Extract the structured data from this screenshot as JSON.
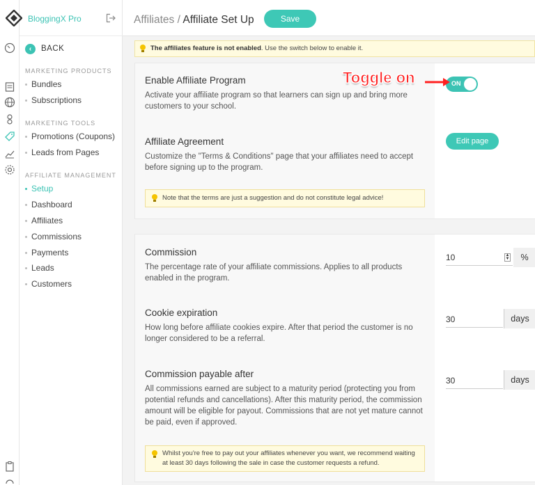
{
  "brand": {
    "name": "BloggingX Pro"
  },
  "breadcrumb": {
    "parent": "Affiliates",
    "separator": " / ",
    "current": "Affiliate Set Up"
  },
  "toolbar": {
    "save_label": "Save"
  },
  "sidebar": {
    "back_label": "BACK",
    "sections": [
      {
        "label": "MARKETING PRODUCTS",
        "items": [
          "Bundles",
          "Subscriptions"
        ]
      },
      {
        "label": "MARKETING TOOLS",
        "items": [
          "Promotions (Coupons)",
          "Leads from Pages"
        ]
      },
      {
        "label": "AFFILIATE MANAGEMENT",
        "items": [
          "Setup",
          "Dashboard",
          "Affiliates",
          "Commissions",
          "Payments",
          "Leads",
          "Customers"
        ]
      }
    ],
    "active_item": "Setup"
  },
  "banner": {
    "bold": "The affiliates feature is not enabled",
    "rest": ". Use the switch below to enable it."
  },
  "program": {
    "enable": {
      "title": "Enable Affiliate Program",
      "desc": "Activate your affiliate program so that learners can sign up and bring more customers to your school.",
      "toggle_label": "ON"
    },
    "agreement": {
      "title": "Affiliate Agreement",
      "desc": "Customize the \"Terms & Conditions\" page that your affiliates need to accept before signing up to the program.",
      "button": "Edit page",
      "note": "Note that the terms are just a suggestion and do not constitute legal advice!"
    }
  },
  "settings": {
    "commission": {
      "title": "Commission",
      "desc": "The percentage rate of your affiliate commissions. Applies to all products enabled in the program.",
      "value": "10",
      "unit": "%"
    },
    "cookie": {
      "title": "Cookie expiration",
      "desc": "How long before affiliate cookies expire. After that period the customer is no longer considered to be a referral.",
      "value": "30",
      "unit": "days"
    },
    "payable": {
      "title": "Commission payable after",
      "desc": "All commissions earned are subject to a maturity period (protecting you from potential refunds and cancellations). After this maturity period, the commission amount will be eligible for payout. Commissions that are not yet mature cannot be paid, even if approved.",
      "value": "30",
      "unit": "days",
      "note": "Whilst you're free to pay out your affiliates whenever you want, we recommend waiting at least 30 days following the sale in case the customer requests a refund."
    }
  },
  "annotation": {
    "text": "Toggle on"
  },
  "colors": {
    "accent": "#3cc3b4",
    "annotation": "#ff2020",
    "note_bg": "#fffbdf"
  }
}
